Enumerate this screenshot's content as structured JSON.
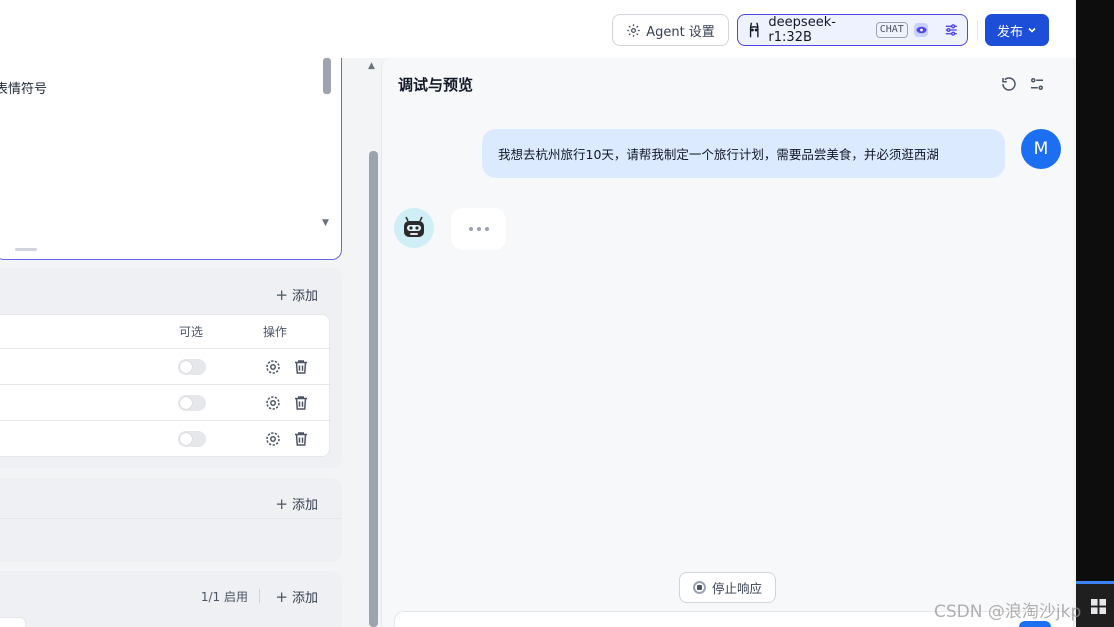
{
  "header": {
    "agent_settings_label": "Agent 设置",
    "model_name": "deepseek-r1:32B",
    "model_badge": "CHAT",
    "publish_label": "发布"
  },
  "prompt_editor": {
    "line1": "-",
    "line2": "表情符号"
  },
  "variables_section": {
    "add_label": "添加",
    "columns": [
      "可选",
      "操作"
    ],
    "rows": [
      {
        "optional": false
      },
      {
        "optional": false
      },
      {
        "optional": false
      }
    ]
  },
  "section2": {
    "add_label": "添加"
  },
  "section3": {
    "status": "1/1 启用",
    "add_label": "添加"
  },
  "chat": {
    "title": "调试与预览",
    "user_message": "我想去杭州旅行10天，请帮我制定一个旅行计划，需要品尝美食，并必须逛西湖",
    "user_initial": "M",
    "stop_label": "停止响应"
  },
  "watermark": "CSDN @浪淘沙jkp",
  "colors": {
    "primary": "#1d4ed8",
    "accent_border": "#6366f1",
    "user_bubble": "#dbeafe"
  }
}
